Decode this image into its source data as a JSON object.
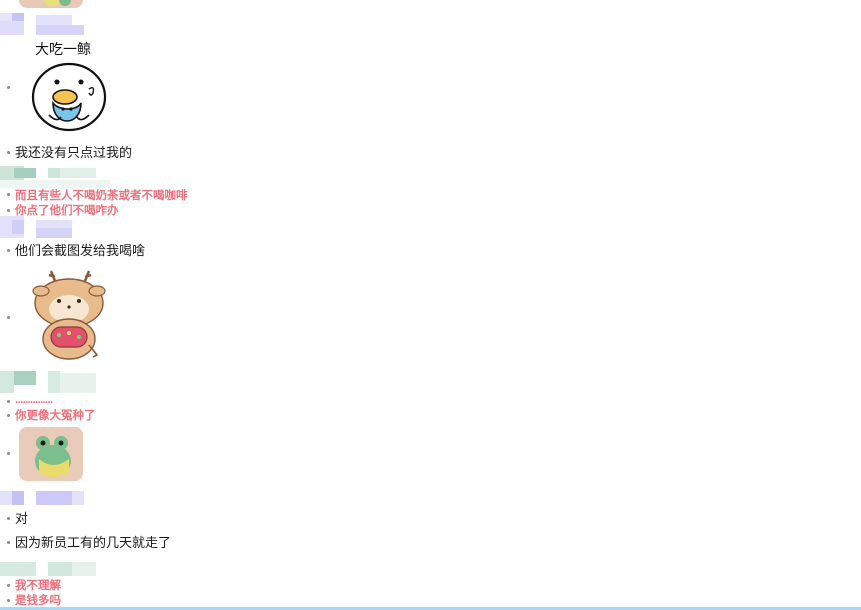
{
  "messages": [
    {
      "type": "sticker",
      "sender": "blue",
      "sticker": "frog-partial"
    },
    {
      "type": "sticker",
      "sender": "blue",
      "sticker": "duck-eat",
      "caption": "大吃一鲸"
    },
    {
      "type": "text",
      "sender": "blue",
      "text": "我还没有只点过我的"
    },
    {
      "type": "text",
      "sender": "green",
      "text": "而且有些人不喝奶茶或者不喝咖啡",
      "style": "red-bold"
    },
    {
      "type": "text",
      "sender": "green",
      "text": "你点了他们不喝咋办",
      "style": "red-bold"
    },
    {
      "type": "text",
      "sender": "blue",
      "text": "他们会截图发给我喝啥"
    },
    {
      "type": "sticker",
      "sender": "blue",
      "sticker": "deer-cake"
    },
    {
      "type": "text",
      "sender": "green",
      "text": "...............",
      "style": "red-bold"
    },
    {
      "type": "text",
      "sender": "green",
      "text": "你更像大冤种了",
      "style": "red-bold"
    },
    {
      "type": "sticker",
      "sender": "green",
      "sticker": "frog"
    },
    {
      "type": "text",
      "sender": "blue",
      "text": "对"
    },
    {
      "type": "text",
      "sender": "blue",
      "text": "因为新员工有的几天就走了"
    },
    {
      "type": "text",
      "sender": "green",
      "text": "我不理解",
      "style": "red-bold"
    },
    {
      "type": "text",
      "sender": "green",
      "text": "是钱多吗",
      "style": "red-bold"
    }
  ],
  "colors": {
    "red_text": "#f0707a",
    "blue_avatar": "#c9c6f7",
    "green_avatar": "#a7d3bf",
    "bottom_bar": "#a9d8f2"
  }
}
